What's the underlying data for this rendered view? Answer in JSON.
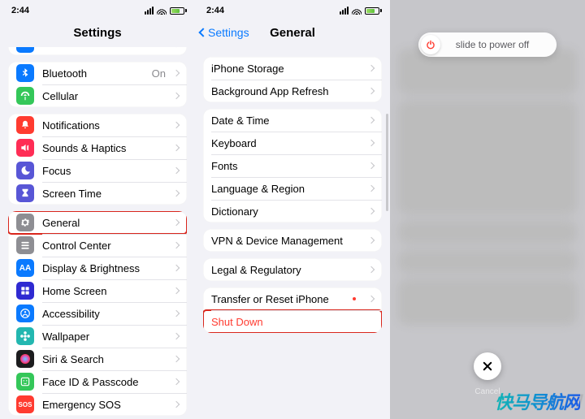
{
  "status": {
    "time": "2:44"
  },
  "panel1": {
    "title": "Settings",
    "groups": [
      {
        "rows": [
          {
            "icon": "bluetooth",
            "bg": "#0a7aff",
            "glyph": "bt",
            "label": "Bluetooth",
            "value": "On"
          },
          {
            "icon": "cellular",
            "bg": "#34c759",
            "glyph": "ant",
            "label": "Cellular"
          }
        ]
      },
      {
        "rows": [
          {
            "icon": "notifications",
            "bg": "#ff3b30",
            "glyph": "bell",
            "label": "Notifications"
          },
          {
            "icon": "sounds",
            "bg": "#ff2d55",
            "glyph": "speaker",
            "label": "Sounds & Haptics"
          },
          {
            "icon": "focus",
            "bg": "#5856d6",
            "glyph": "moon",
            "label": "Focus"
          },
          {
            "icon": "screentime",
            "bg": "#5856d6",
            "glyph": "hourglass",
            "label": "Screen Time"
          }
        ]
      },
      {
        "rows": [
          {
            "icon": "general",
            "bg": "#8e8e93",
            "glyph": "gear",
            "label": "General",
            "hl": true
          },
          {
            "icon": "controlcenter",
            "bg": "#8e8e93",
            "glyph": "sliders",
            "label": "Control Center"
          },
          {
            "icon": "display",
            "bg": "#0a7aff",
            "glyph": "AA",
            "label": "Display & Brightness"
          },
          {
            "icon": "homescreen",
            "bg": "#2f2ad1",
            "glyph": "grid",
            "label": "Home Screen"
          },
          {
            "icon": "accessibility",
            "bg": "#0a7aff",
            "glyph": "person",
            "label": "Accessibility"
          },
          {
            "icon": "wallpaper",
            "bg": "#23b7b0",
            "glyph": "flower",
            "label": "Wallpaper"
          },
          {
            "icon": "siri",
            "bg": "#1c1c1e",
            "glyph": "siri",
            "label": "Siri & Search"
          },
          {
            "icon": "faceid",
            "bg": "#34c759",
            "glyph": "face",
            "label": "Face ID & Passcode"
          },
          {
            "icon": "sos",
            "bg": "#ff3b30",
            "glyph": "SOS",
            "label": "Emergency SOS"
          }
        ]
      }
    ]
  },
  "panel2": {
    "back": "Settings",
    "title": "General",
    "groups": [
      {
        "rows": [
          {
            "label": "iPhone Storage"
          },
          {
            "label": "Background App Refresh"
          }
        ]
      },
      {
        "rows": [
          {
            "label": "Date & Time"
          },
          {
            "label": "Keyboard"
          },
          {
            "label": "Fonts"
          },
          {
            "label": "Language & Region"
          },
          {
            "label": "Dictionary"
          }
        ]
      },
      {
        "rows": [
          {
            "label": "VPN & Device Management"
          }
        ]
      },
      {
        "rows": [
          {
            "label": "Legal & Regulatory"
          }
        ]
      },
      {
        "rows": [
          {
            "label": "Transfer or Reset iPhone",
            "dot": true
          },
          {
            "label": "Shut Down",
            "red": true,
            "hl": true,
            "nochev": true
          }
        ]
      }
    ]
  },
  "panel3": {
    "slider_label": "slide to power off",
    "cancel_label": "Cancel"
  },
  "watermark": "快马导航网"
}
